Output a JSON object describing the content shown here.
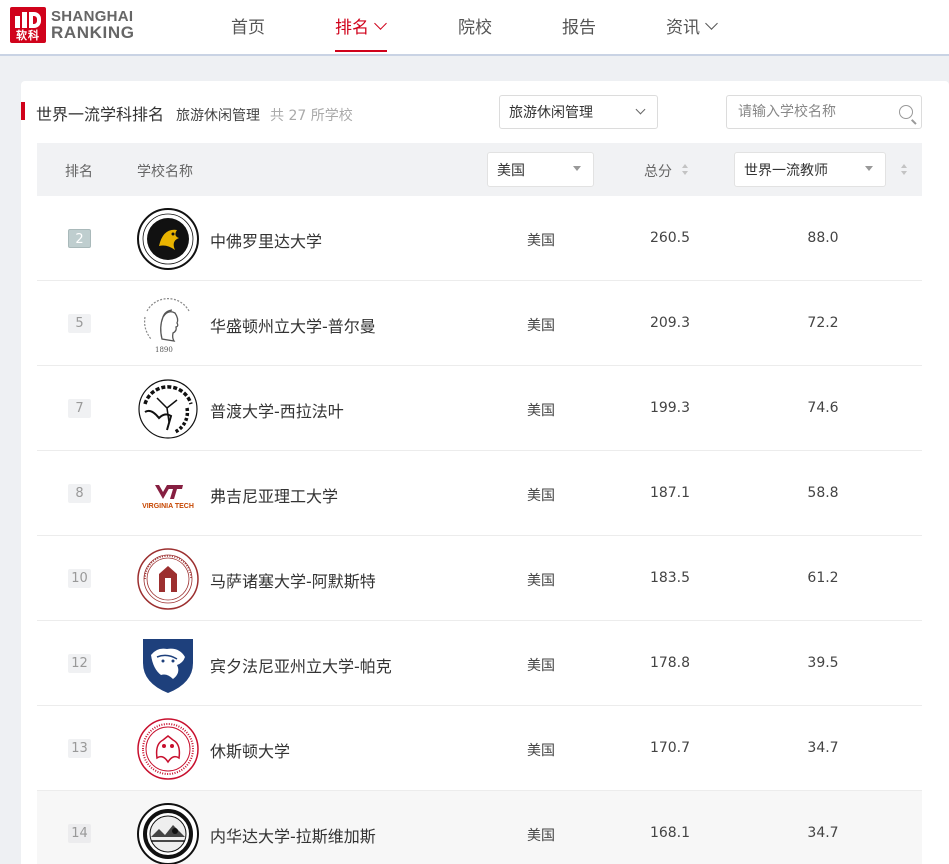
{
  "brand": {
    "cn": "软科",
    "line1": "SHANGHAI",
    "line2": "RANKING",
    "color": "#d0021b"
  },
  "nav": [
    {
      "label": "首页",
      "active": false,
      "dropdown": false
    },
    {
      "label": "排名",
      "active": true,
      "dropdown": true
    },
    {
      "label": "院校",
      "active": false,
      "dropdown": false
    },
    {
      "label": "报告",
      "active": false,
      "dropdown": false
    },
    {
      "label": "资讯",
      "active": false,
      "dropdown": true
    }
  ],
  "page": {
    "title": "世界一流学科排名",
    "subject": "旅游休闲管理",
    "count": "共 27 所学校",
    "subject_select": "旅游休闲管理",
    "search_placeholder": "请输入学校名称"
  },
  "table": {
    "headers": {
      "rank": "排名",
      "name": "学校名称",
      "region_select": "美国",
      "score": "总分",
      "indicator_select": "世界一流教师"
    },
    "rows": [
      {
        "rank": "2",
        "name": "中佛罗里达大学",
        "region": "美国",
        "score": "260.5",
        "indicator": "88.0",
        "logo": "ucf-seal-icon"
      },
      {
        "rank": "5",
        "name": "华盛顿州立大学-普尔曼",
        "region": "美国",
        "score": "209.3",
        "indicator": "72.2",
        "logo": "wsu-seal-icon",
        "logo_text": "1890"
      },
      {
        "rank": "7",
        "name": "普渡大学-西拉法叶",
        "region": "美国",
        "score": "199.3",
        "indicator": "74.6",
        "logo": "purdue-seal-icon"
      },
      {
        "rank": "8",
        "name": "弗吉尼亚理工大学",
        "region": "美国",
        "score": "187.1",
        "indicator": "58.8",
        "logo": "virginia-tech-logo-icon",
        "logo_text": "VIRGINIA TECH"
      },
      {
        "rank": "10",
        "name": "马萨诸塞大学-阿默斯特",
        "region": "美国",
        "score": "183.5",
        "indicator": "61.2",
        "logo": "umass-seal-icon"
      },
      {
        "rank": "12",
        "name": "宾夕法尼亚州立大学-帕克",
        "region": "美国",
        "score": "178.8",
        "indicator": "39.5",
        "logo": "penn-state-shield-icon"
      },
      {
        "rank": "13",
        "name": "休斯顿大学",
        "region": "美国",
        "score": "170.7",
        "indicator": "34.7",
        "logo": "uh-seal-icon"
      },
      {
        "rank": "14",
        "name": "内华达大学-拉斯维加斯",
        "region": "美国",
        "score": "168.1",
        "indicator": "34.7",
        "logo": "unlv-seal-icon"
      }
    ]
  }
}
